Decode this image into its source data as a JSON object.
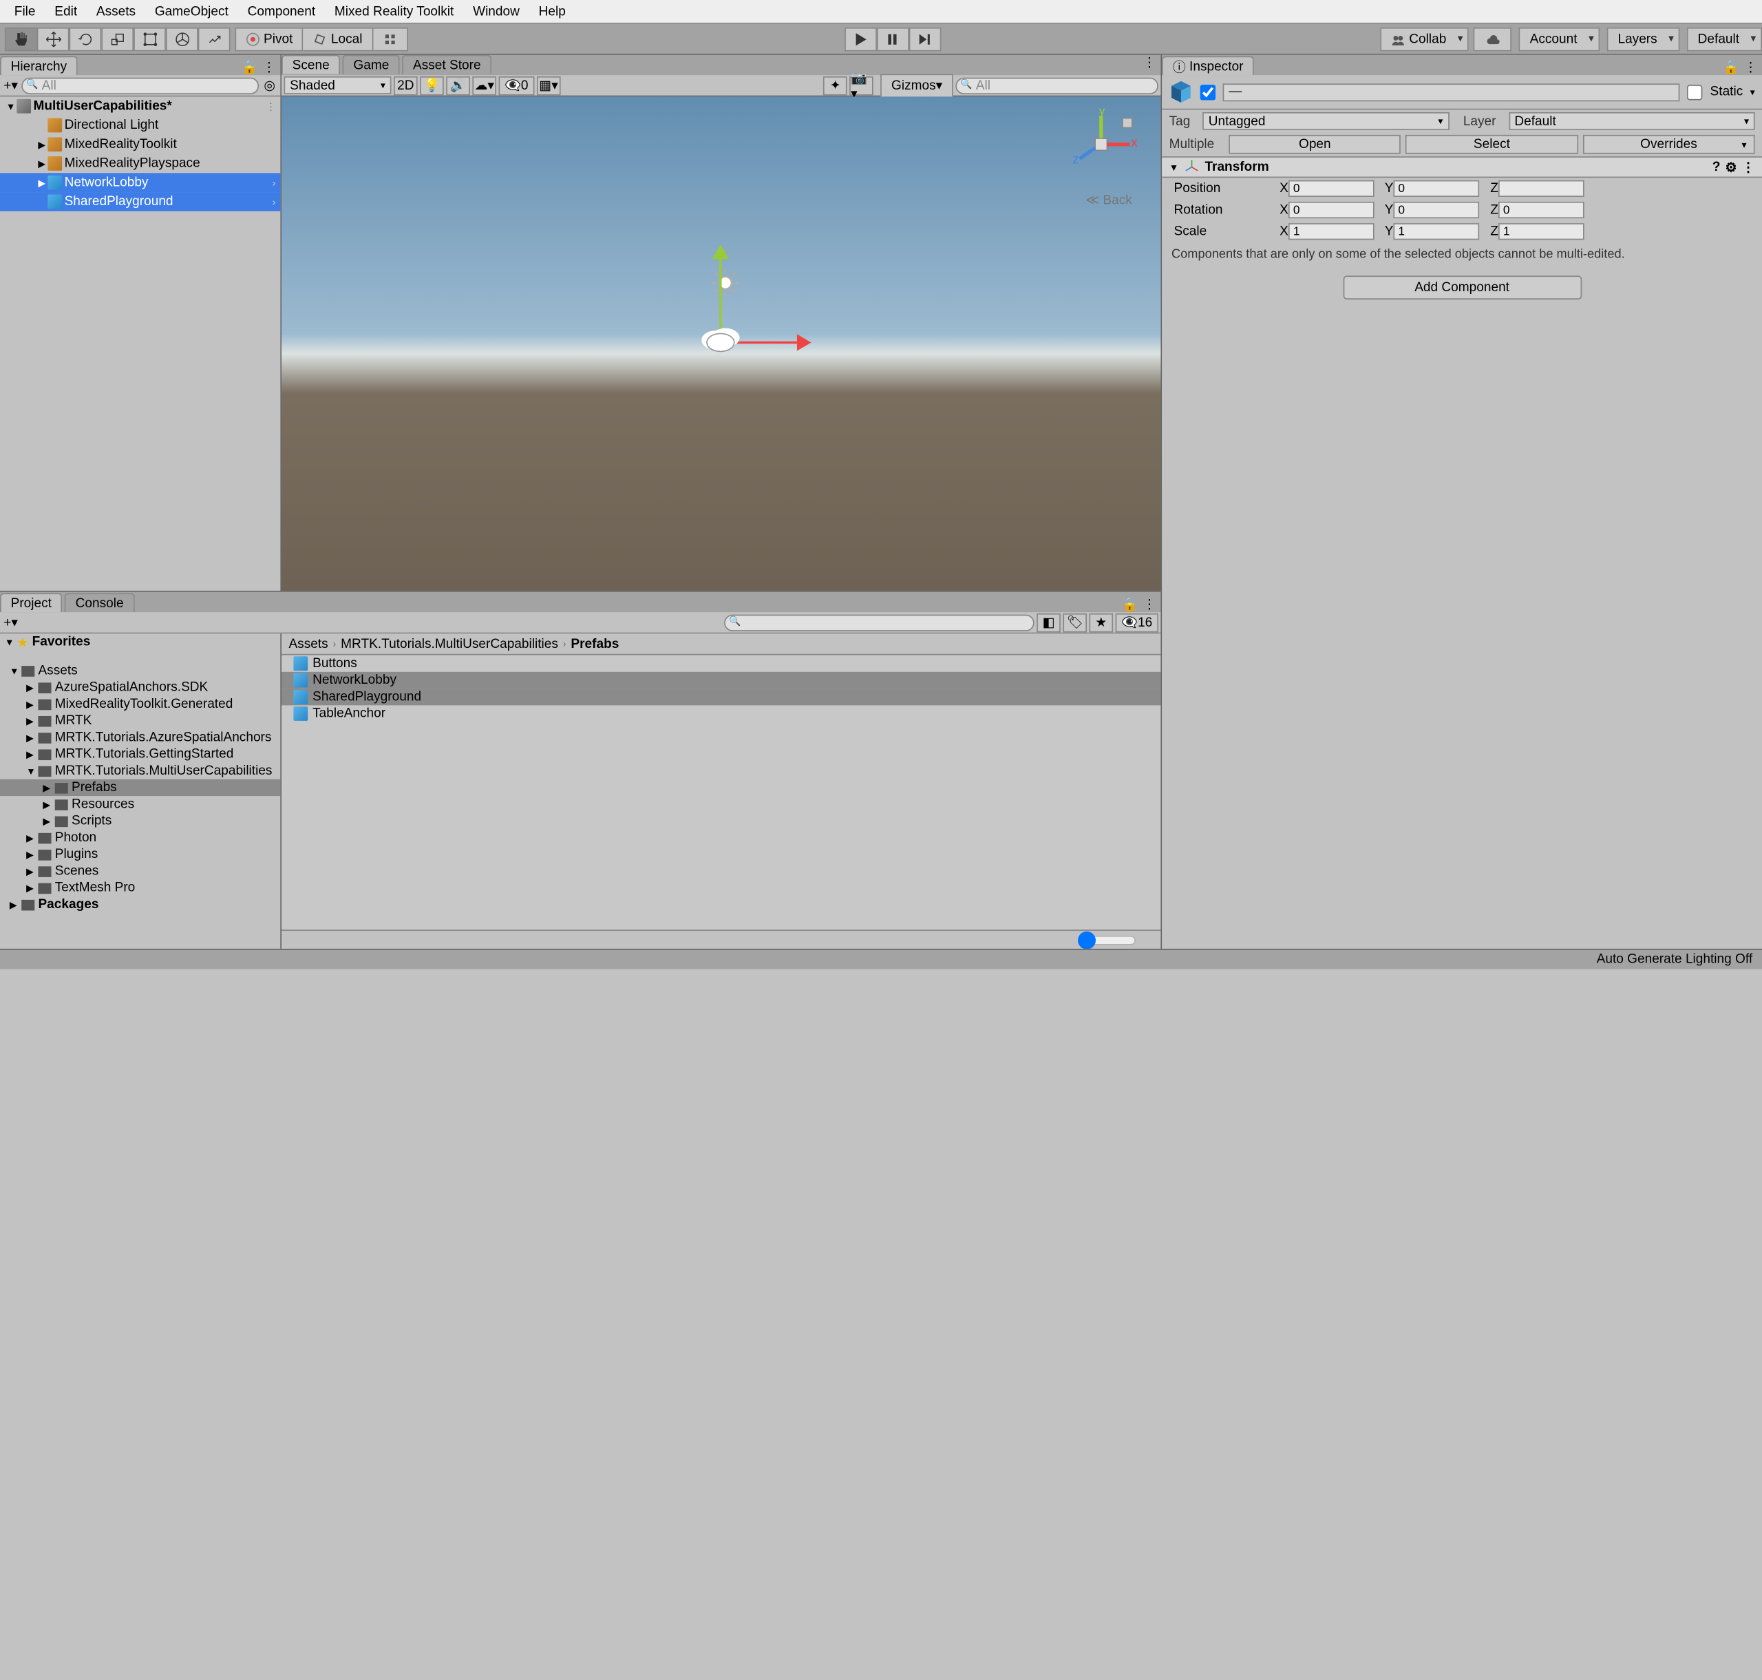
{
  "menus": [
    "File",
    "Edit",
    "Assets",
    "GameObject",
    "Component",
    "Mixed Reality Toolkit",
    "Window",
    "Help"
  ],
  "toolbar": {
    "pivot": "Pivot",
    "local": "Local",
    "collab": "Collab",
    "account": "Account",
    "layers": "Layers",
    "layout": "Default"
  },
  "hierarchy": {
    "title": "Hierarchy",
    "search_placeholder": "All",
    "root": "MultiUserCapabilities*",
    "items": [
      {
        "label": "Directional Light",
        "indent": 1,
        "sel": false,
        "icon": "orange",
        "fold": ""
      },
      {
        "label": "MixedRealityToolkit",
        "indent": 1,
        "sel": false,
        "icon": "orange",
        "fold": "▶"
      },
      {
        "label": "MixedRealityPlayspace",
        "indent": 1,
        "sel": false,
        "icon": "orange",
        "fold": "▶"
      },
      {
        "label": "NetworkLobby",
        "indent": 1,
        "sel": true,
        "icon": "blue",
        "fold": "▶",
        "arrow": true
      },
      {
        "label": "SharedPlayground",
        "indent": 1,
        "sel": true,
        "icon": "blue",
        "fold": "",
        "arrow": true
      }
    ]
  },
  "tabs": {
    "scene": "Scene",
    "game": "Game",
    "asset": "Asset Store"
  },
  "scenebar": {
    "shaded": "Shaded",
    "twod": "2D",
    "gizmos": "Gizmos",
    "hidden": "0",
    "search_placeholder": "All",
    "back": "Back"
  },
  "project": {
    "title": "Project",
    "console": "Console",
    "slider_count": "16",
    "favorites": "Favorites",
    "tree": [
      {
        "label": "Assets",
        "indent": 0,
        "open": true
      },
      {
        "label": "AzureSpatialAnchors.SDK",
        "indent": 1
      },
      {
        "label": "MixedRealityToolkit.Generated",
        "indent": 1
      },
      {
        "label": "MRTK",
        "indent": 1
      },
      {
        "label": "MRTK.Tutorials.AzureSpatialAnchors",
        "indent": 1
      },
      {
        "label": "MRTK.Tutorials.GettingStarted",
        "indent": 1
      },
      {
        "label": "MRTK.Tutorials.MultiUserCapabilities",
        "indent": 1,
        "open": true
      },
      {
        "label": "Prefabs",
        "indent": 2,
        "sel": true
      },
      {
        "label": "Resources",
        "indent": 2
      },
      {
        "label": "Scripts",
        "indent": 2
      },
      {
        "label": "Photon",
        "indent": 1
      },
      {
        "label": "Plugins",
        "indent": 1
      },
      {
        "label": "Scenes",
        "indent": 1
      },
      {
        "label": "TextMesh Pro",
        "indent": 1
      },
      {
        "label": "Packages",
        "indent": 0,
        "bold": true
      }
    ],
    "breadcrumb": [
      "Assets",
      "MRTK.Tutorials.MultiUserCapabilities",
      "Prefabs"
    ],
    "files": [
      {
        "label": "Buttons",
        "sel": false
      },
      {
        "label": "NetworkLobby",
        "sel": true
      },
      {
        "label": "SharedPlayground",
        "sel": true
      },
      {
        "label": "TableAnchor",
        "sel": false
      }
    ]
  },
  "inspector": {
    "title": "Inspector",
    "dash": "—",
    "static": "Static",
    "tag_label": "Tag",
    "tag_value": "Untagged",
    "layer_label": "Layer",
    "layer_value": "Default",
    "multiple": "Multiple",
    "open": "Open",
    "select": "Select",
    "overrides": "Overrides",
    "transform": "Transform",
    "position": "Position",
    "rotation": "Rotation",
    "scale": "Scale",
    "pos": {
      "x": "0",
      "y": "0",
      "z": ""
    },
    "rot": {
      "x": "0",
      "y": "0",
      "z": "0"
    },
    "scl": {
      "x": "1",
      "y": "1",
      "z": "1"
    },
    "warn": "Components that are only on some of the selected objects cannot be multi-edited.",
    "addcomp": "Add Component"
  },
  "status": {
    "lighting": "Auto Generate Lighting Off"
  },
  "axis": {
    "x": "x",
    "y": "y",
    "z": "z"
  }
}
